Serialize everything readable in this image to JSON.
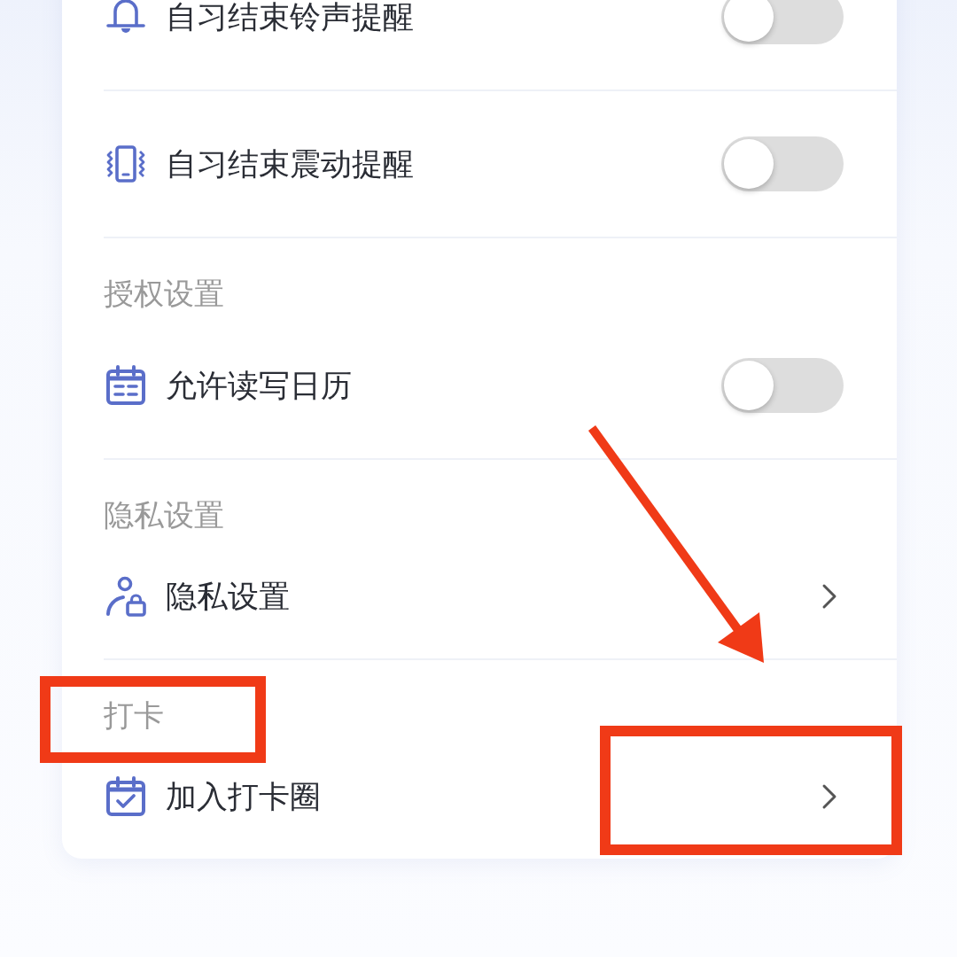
{
  "sections": [
    {
      "rows": [
        {
          "kind": "toggle",
          "label": "自习结束铃声提醒",
          "on": false
        },
        {
          "kind": "toggle",
          "label": "自习结束震动提醒",
          "on": false
        }
      ]
    },
    {
      "title": "授权设置",
      "highlighted": false,
      "rows": [
        {
          "kind": "toggle",
          "label": "允许读写日历",
          "on": false
        }
      ]
    },
    {
      "title": "隐私设置",
      "highlighted": false,
      "rows": [
        {
          "kind": "link",
          "label": "隐私设置",
          "highlighted": false,
          "arrow_pointing": false
        }
      ]
    },
    {
      "title": "打卡",
      "highlighted": true,
      "rows": [
        {
          "kind": "link",
          "label": "加入打卡圈",
          "highlighted": true,
          "arrow_pointing": true
        }
      ]
    }
  ]
}
